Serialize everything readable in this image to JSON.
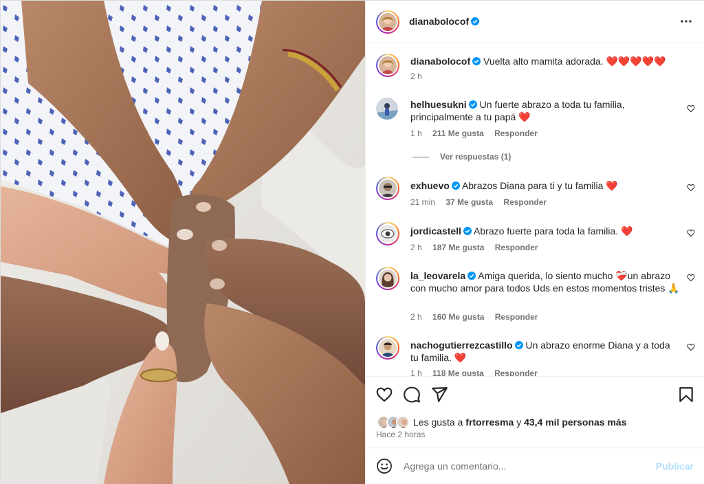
{
  "post": {
    "author": "dianabolocof",
    "caption_user": "dianabolocof",
    "caption_text": "Vuelta alto mamita adorada. ❤️❤️❤️❤️❤️",
    "caption_time": "2 h"
  },
  "comments": [
    {
      "user": "helhuesukni",
      "text": "Un fuerte abrazo a toda tu familia, principalmente a tu papá ❤️",
      "time": "1 h",
      "likes": "211 Me gusta",
      "reply": "Responder"
    },
    {
      "user": "exhuevo",
      "text": "Abrazos Diana para ti y tu familia ❤️",
      "time": "21 min",
      "likes": "37 Me gusta",
      "reply": "Responder"
    },
    {
      "user": "jordicastell",
      "text": "Abrazo fuerte para toda la familia. ❤️",
      "time": "2 h",
      "likes": "187 Me gusta",
      "reply": "Responder"
    },
    {
      "user": "la_leovarela",
      "text": "Amiga querida, lo siento mucho ❤️‍🩹un abrazo con mucho amor para todos Uds en estos momentos tristes 🙏",
      "time": "2 h",
      "likes": "160 Me gusta",
      "reply": "Responder"
    },
    {
      "user": "nachogutierrezcastillo",
      "text": "Un abrazo enorme Diana y a toda tu familia. ❤️",
      "time": "1 h",
      "likes": "118 Me gusta",
      "reply": "Responder"
    }
  ],
  "view_replies": "Ver respuestas (1)",
  "likes": {
    "prefix": "Les gusta a",
    "user": "frtorresma",
    "connector": "y",
    "others": "43,4 mil personas más"
  },
  "timestamp": "Hace 2 horas",
  "composer": {
    "placeholder": "Agrega un comentario...",
    "publish": "Publicar"
  },
  "icons": {
    "verified": "verified-badge-icon",
    "more": "more-options-icon",
    "like": "heart-icon",
    "comment": "comment-icon",
    "share": "share-icon",
    "save": "bookmark-icon",
    "emoji": "emoji-icon"
  },
  "colors": {
    "verified": "#0095f6",
    "publish_disabled": "#b2dffc",
    "secondary_text": "#737373",
    "heart": "#ed4956"
  }
}
